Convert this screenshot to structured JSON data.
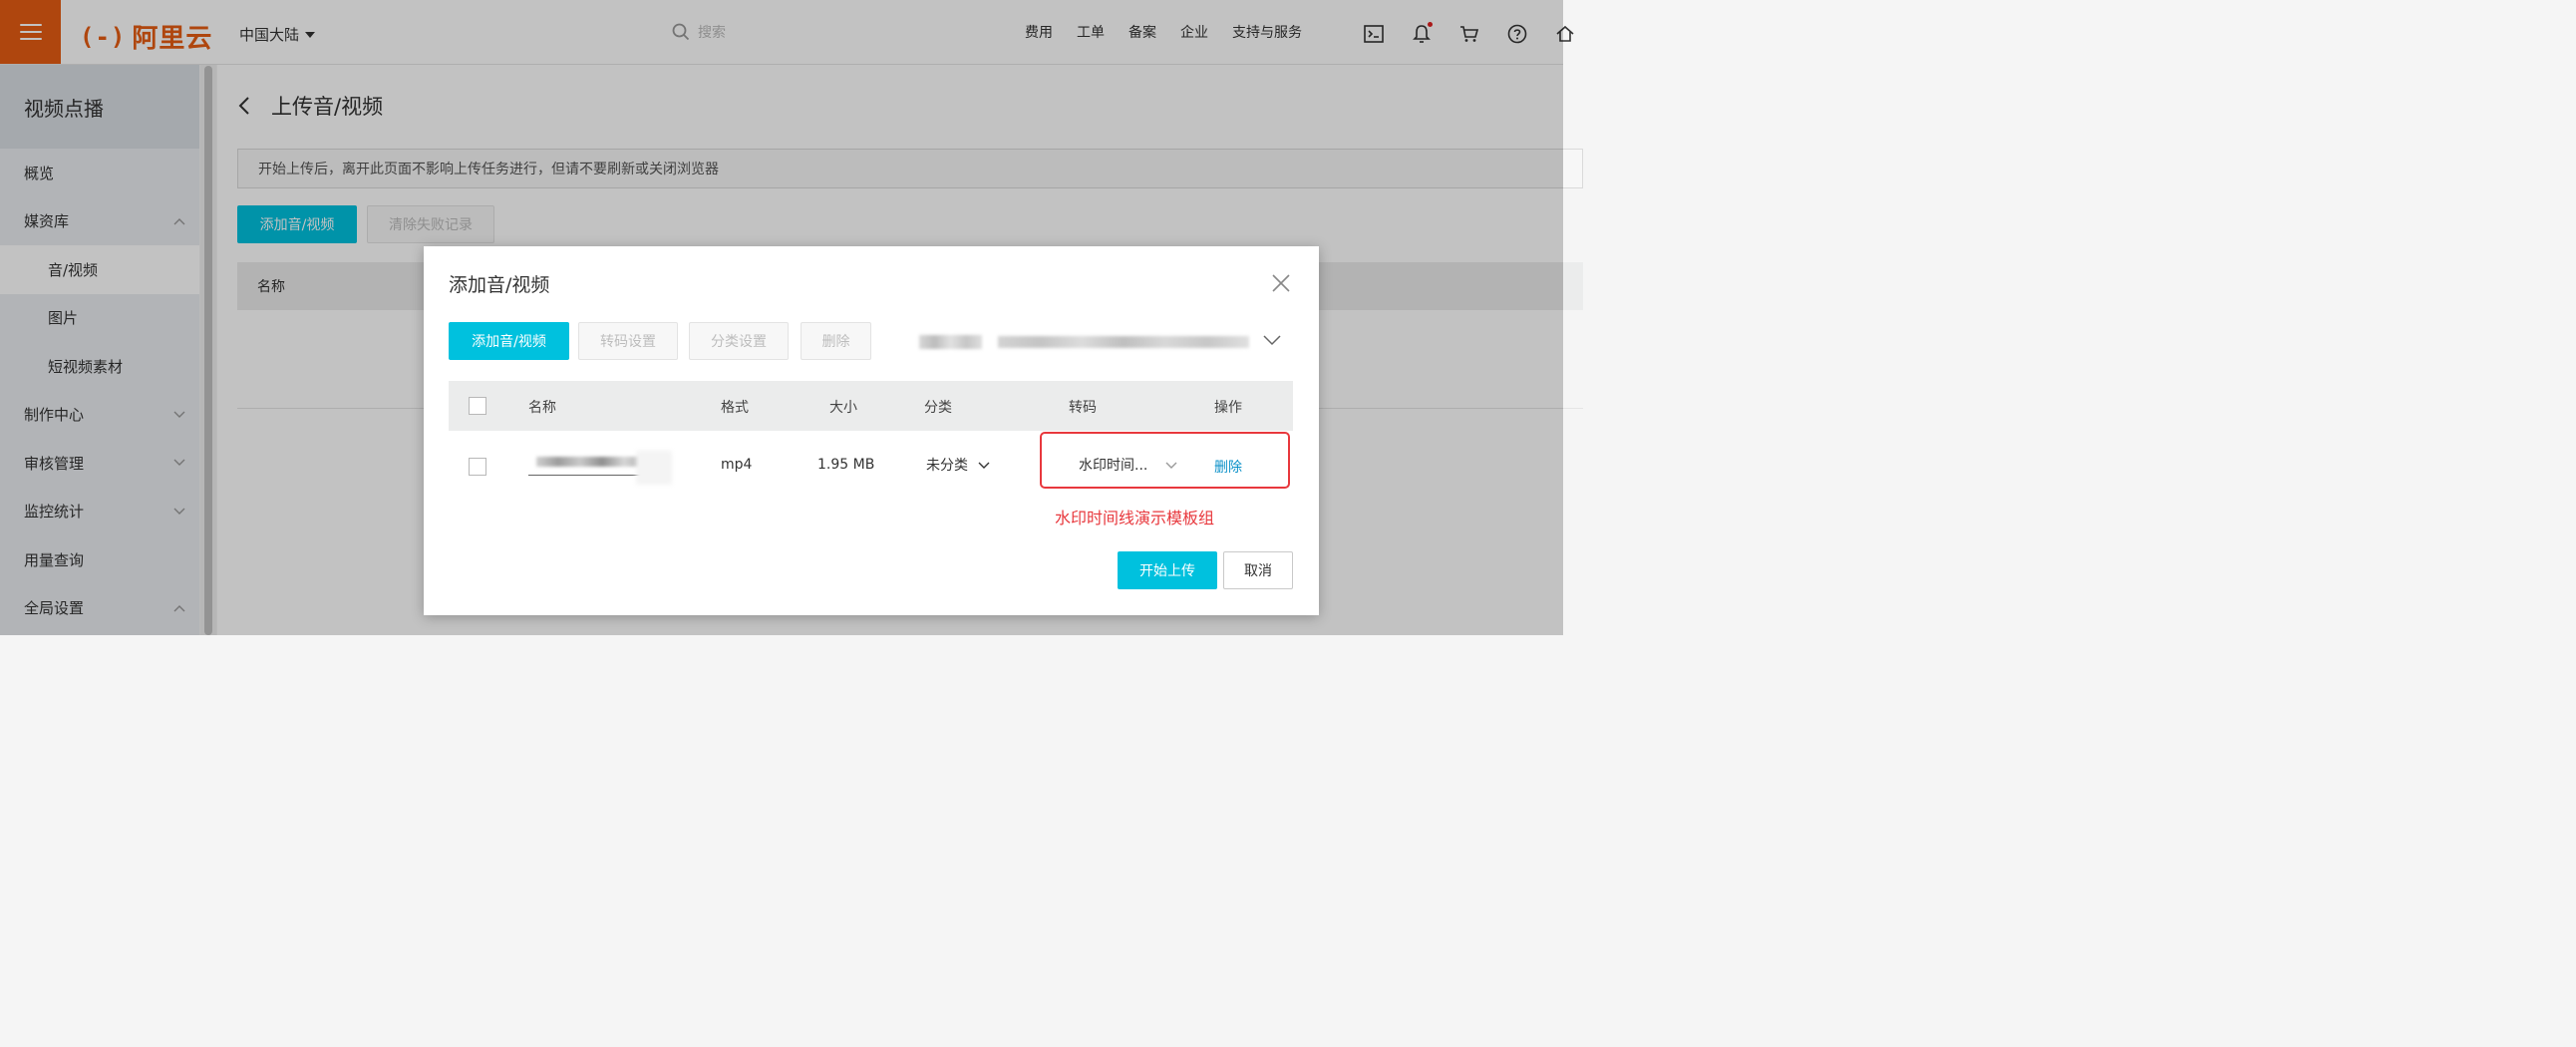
{
  "header": {
    "logo_text": "阿里云",
    "logo_mark": "(-)",
    "region": "中国大陆",
    "search_placeholder": "搜索",
    "nav": [
      "费用",
      "工单",
      "备案",
      "企业",
      "支持与服务"
    ],
    "icons": [
      "terminal-icon",
      "bell-icon",
      "cart-icon",
      "help-icon",
      "home-icon"
    ],
    "brand_color": "#e75d13"
  },
  "sidebar": {
    "title": "视频点播",
    "items": [
      {
        "label": "概览"
      },
      {
        "label": "媒资库"
      },
      {
        "label": "音/视频"
      },
      {
        "label": "图片"
      },
      {
        "label": "短视频素材"
      },
      {
        "label": "制作中心"
      },
      {
        "label": "审核管理"
      },
      {
        "label": "监控统计"
      },
      {
        "label": "用量查询"
      },
      {
        "label": "全局设置"
      }
    ]
  },
  "main": {
    "title": "上传音/视频",
    "notice": "开始上传后，离开此页面不影响上传任务进行，但请不要刷新或关闭浏览器",
    "add_button": "添加音/视频",
    "clear_button": "清除失败记录",
    "table_header_name": "名称"
  },
  "modal": {
    "title": "添加音/视频",
    "toolbar": {
      "add": "添加音/视频",
      "transcode_settings": "转码设置",
      "category_settings": "分类设置",
      "delete": "删除"
    },
    "columns": {
      "name": "名称",
      "format": "格式",
      "size": "大小",
      "category": "分类",
      "transcode": "转码",
      "action": "操作"
    },
    "row": {
      "format": "mp4",
      "size": "1.95 MB",
      "category": "未分类",
      "transcode": "水印时间...",
      "action": "删除"
    },
    "annotation": "水印时间线演示模板组",
    "start_upload": "开始上传",
    "cancel": "取消",
    "accent_color": "#00c1de",
    "highlight_color": "#e8383d"
  }
}
